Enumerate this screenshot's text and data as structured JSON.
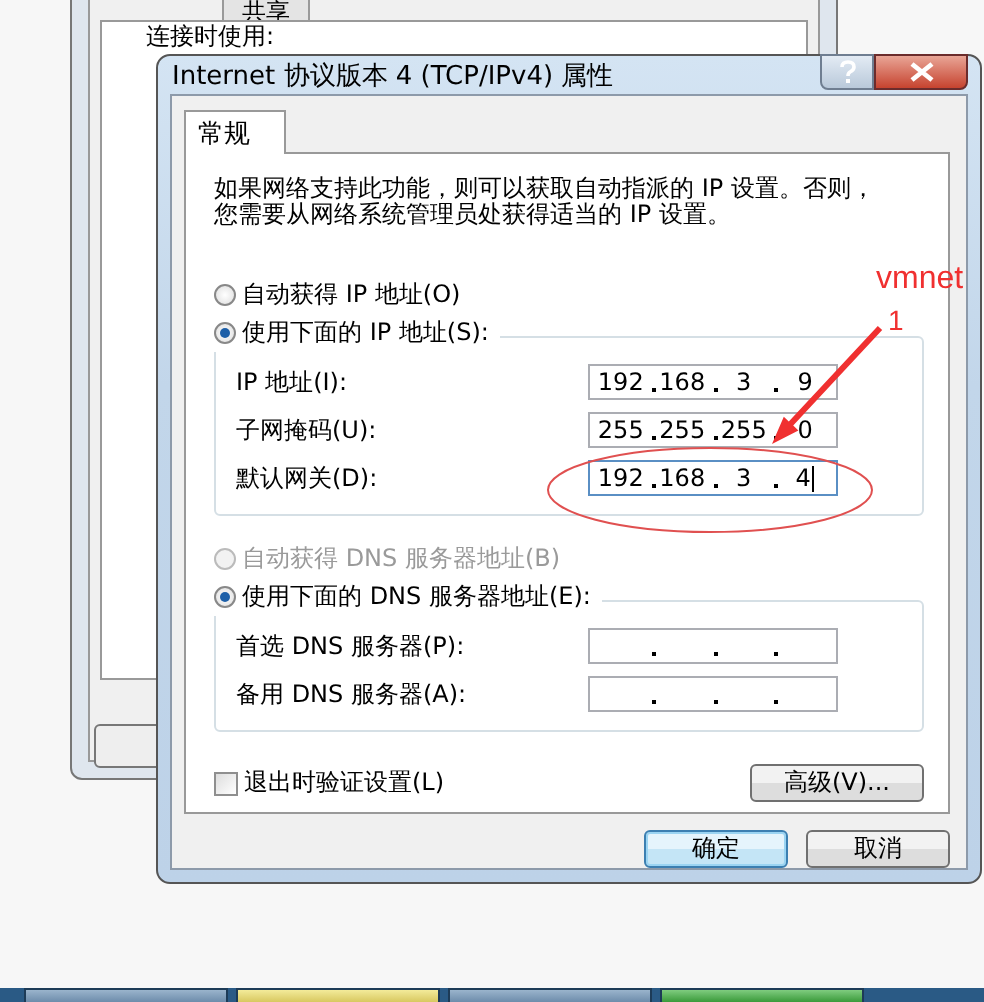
{
  "background_window": {
    "tabs": [
      {
        "label": "共享",
        "selected": false
      }
    ],
    "labels": [
      "连接时使用:"
    ]
  },
  "dialog": {
    "title": "Internet 协议版本 4 (TCP/IPv4) 属性",
    "tabs": [
      {
        "label": "常规",
        "selected": true
      }
    ],
    "description": [
      "如果网络支持此功能，则可以获取自动指派的 IP 设置。否则，",
      "您需要从网络系统管理员处获得适当的 IP 设置。"
    ],
    "ip_mode": [
      {
        "label": "自动获得 IP 地址(O)",
        "selected": false,
        "disabled": false
      },
      {
        "label": "使用下面的 IP 地址(S):",
        "selected": true,
        "disabled": false
      }
    ],
    "ip_fields": [
      {
        "label": "IP 地址(I):",
        "octets": [
          "192",
          "168",
          "3",
          "9"
        ],
        "focused": false
      },
      {
        "label": "子网掩码(U):",
        "octets": [
          "255",
          "255",
          "255",
          "0"
        ],
        "focused": false
      },
      {
        "label": "默认网关(D):",
        "octets": [
          "192",
          "168",
          "3",
          "4"
        ],
        "focused": true
      }
    ],
    "dns_mode": [
      {
        "label": "自动获得 DNS 服务器地址(B)",
        "selected": false,
        "disabled": true
      },
      {
        "label": "使用下面的 DNS 服务器地址(E):",
        "selected": true,
        "disabled": false
      }
    ],
    "dns_fields": [
      {
        "label": "首选 DNS 服务器(P):",
        "focused": false
      },
      {
        "label": "备用 DNS 服务器(A):",
        "focused": false
      }
    ],
    "validate_on_exit": {
      "label": "退出时验证设置(L)",
      "checked": false
    },
    "advanced_button": "高级(V)...",
    "buttons": [
      {
        "label": "确定",
        "default": true
      },
      {
        "label": "取消",
        "default": false
      }
    ]
  },
  "annotation": {
    "text": "vmnet",
    "subtext": "1"
  }
}
